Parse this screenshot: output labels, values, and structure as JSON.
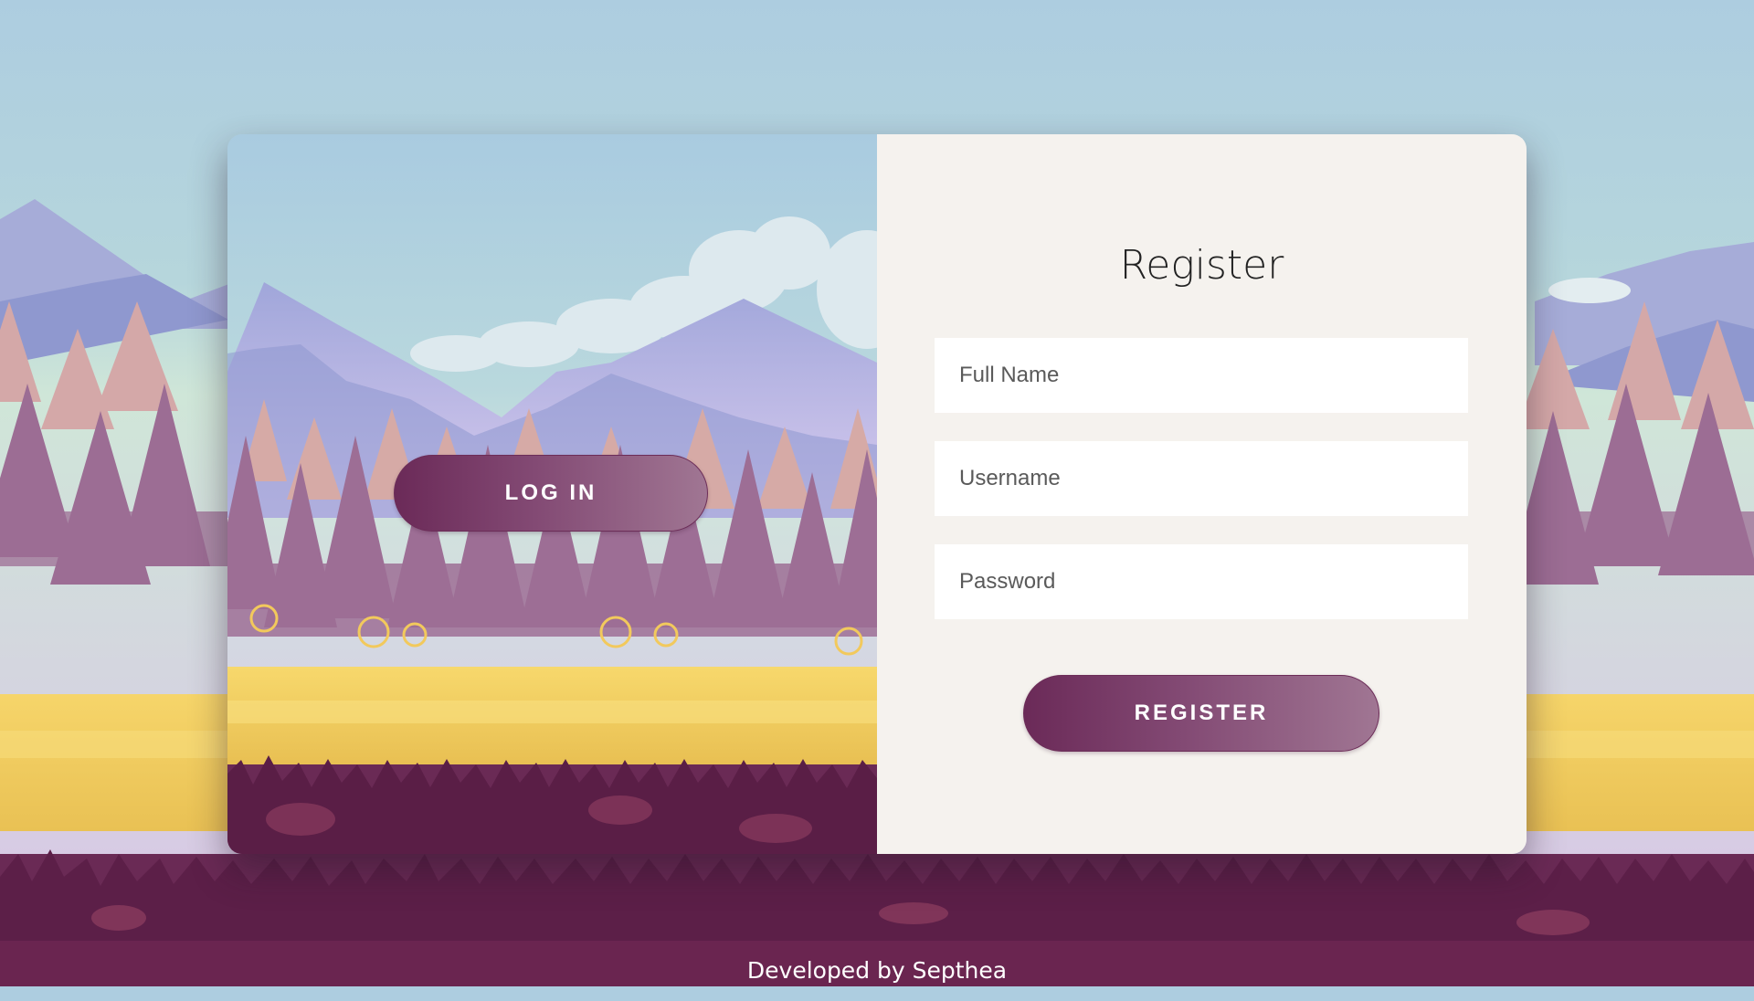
{
  "login_panel": {
    "login_label": "LOG IN"
  },
  "register_form": {
    "title": "Register",
    "full_name_placeholder": "Full Name",
    "username_placeholder": "Username",
    "password_placeholder": "Password",
    "register_label": "REGISTER"
  },
  "footer": {
    "credit": "Developed by Septhea"
  },
  "colors": {
    "sky": "#adcde0",
    "button_dark": "#6b2a58",
    "button_light": "#a07693",
    "panel_bg": "#f5f2ee",
    "footer_bg": "#6a2550"
  }
}
